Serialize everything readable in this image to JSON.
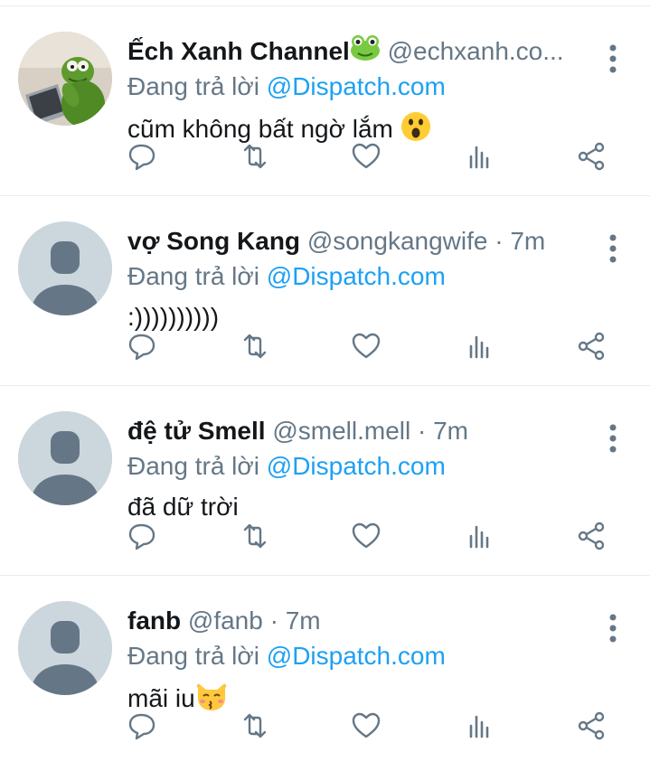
{
  "replies": [
    {
      "name": "Ếch Xanh Channel",
      "name_emoji": "frog-face-icon",
      "handle": "@echxanh.co...",
      "separator": "",
      "time": "",
      "replying_prefix": "Đang trả lời",
      "replying_to": "@Dispatch.com",
      "text": "cũm không bất ngờ lắm",
      "text_emoji": "astonished-face-icon",
      "avatar": "kermit-photo"
    },
    {
      "name": "vợ Song Kang",
      "handle": "@songkangwife",
      "separator": "·",
      "time": "7m",
      "replying_prefix": "Đang trả lời",
      "replying_to": "@Dispatch.com",
      "text": ":))))))))))",
      "avatar": "default-profile"
    },
    {
      "name": "đệ tử Smell",
      "handle": "@smell.mell",
      "separator": "·",
      "time": "7m",
      "replying_prefix": "Đang trả lời",
      "replying_to": "@Dispatch.com",
      "text": "đã dữ trời",
      "avatar": "default-profile"
    },
    {
      "name": "fanb",
      "handle": "@fanb",
      "separator": "·",
      "time": "7m",
      "replying_prefix": "Đang trả lời",
      "replying_to": "@Dispatch.com",
      "text": "mãi iu",
      "text_emoji": "kissing-cat-icon",
      "avatar": "default-profile"
    }
  ],
  "colors": {
    "accent": "#1da1f2",
    "muted": "#657786",
    "icon": "#657786",
    "divider": "#e6ecf0",
    "avatar_bg": "#ccd6dd",
    "avatar_fg": "#657786"
  },
  "actions": [
    "reply-icon",
    "retweet-icon",
    "like-icon",
    "stats-icon",
    "share-icon"
  ]
}
